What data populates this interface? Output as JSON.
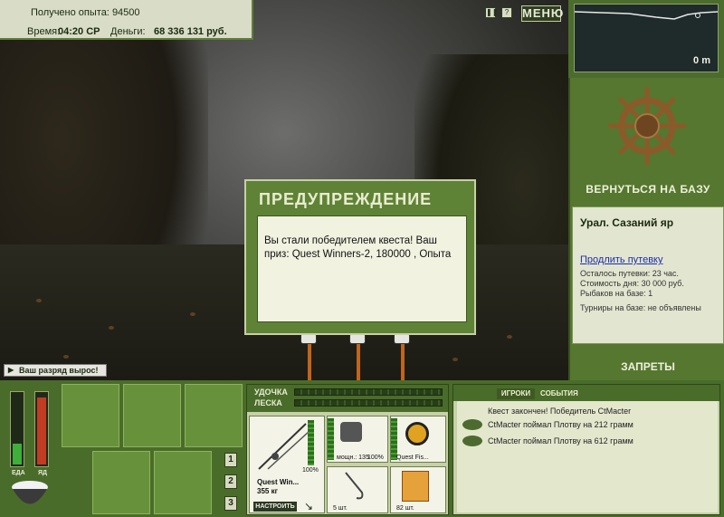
{
  "info": {
    "experience_label": "Получено опыта:",
    "experience_value": "94500",
    "time_label": "Время:",
    "time_value": "04:20 СР",
    "money_label": "Деньги:",
    "money_value": "68 336 131 руб."
  },
  "top_controls": {
    "pause_icon": "pause-icon",
    "help_icon": "help-icon",
    "menu_label": "МЕНЮ"
  },
  "depth": {
    "value": "0 m"
  },
  "right": {
    "return_label": "ВЕРНУТЬСЯ НА БАЗУ",
    "base_name": "Урал. Сазаний яр",
    "extend_link": "Продлить путевку",
    "stats": [
      "Осталось путевки: 23 час.",
      "Стоимость дня: 30 000 руб.",
      "Рыбаков на базе: 1",
      "Турниры на базе: не объявлены"
    ],
    "bans_label": "ЗАПРЕТЫ"
  },
  "dialog": {
    "title": "ПРЕДУПРЕЖДЕНИЕ",
    "message": "Вы стали победителем квеста! Ваш приз: Quest Winners-2, 180000 , Опыта"
  },
  "rank_notice": "Ваш разряд вырос!",
  "meters": {
    "food_label": "ЕДА",
    "poison_label": "ЯД",
    "food_level": 0.3,
    "poison_level": 0.95
  },
  "tackle": {
    "rod_label": "УДОЧКА",
    "line_label": "ЛЕСКА",
    "rod_name": "Quest Win...",
    "rod_weight": "355 кг",
    "rod_percent": "100%",
    "reel_power": "мощн.: 135",
    "reel_percent": "100%",
    "line_name": "Quest Fis...",
    "hook_count": "5 шт.",
    "bait_count": "82 шт.",
    "setup_label": "НАСТРОИТЬ",
    "nums": [
      "1",
      "2",
      "3"
    ]
  },
  "players": {
    "tab_players": "ИГРОКИ",
    "tab_events": "СОБЫТИЯ",
    "messages": [
      "Квест закончен! Победитель CtMacter",
      "CtMacter поймал Плотву на 212 грамм",
      "CtMacter поймал Плотву на 612 грамм"
    ]
  },
  "colors": {
    "panel_green": "#4a6c2a",
    "accent_red": "#c23b25"
  }
}
